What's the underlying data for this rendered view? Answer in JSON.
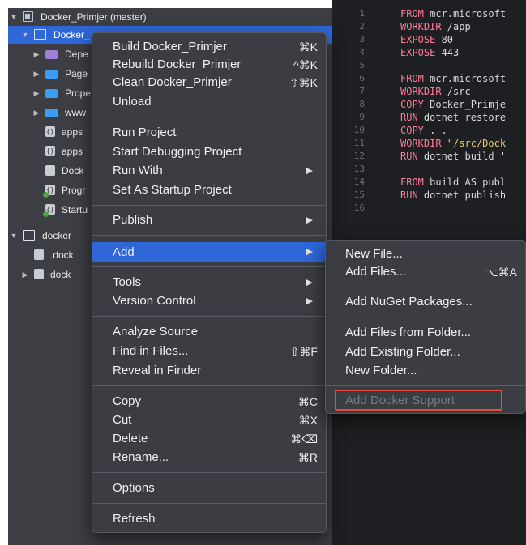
{
  "sidebar": {
    "rows": [
      {
        "label": "Docker_Primjer (master)",
        "twisty": "▼",
        "icon": "solution-icon"
      },
      {
        "label": "Docker_",
        "twisty": "▼",
        "icon": "project-icon"
      },
      {
        "label": "Depe",
        "twisty": "▶",
        "icon": "folder-icon"
      },
      {
        "label": "Page",
        "twisty": "▶",
        "icon": "folder-icon"
      },
      {
        "label": "Prope",
        "twisty": "▶",
        "icon": "folder-icon"
      },
      {
        "label": "www",
        "twisty": "▶",
        "icon": "folder-icon"
      },
      {
        "label": "apps",
        "twisty": "",
        "icon": "json-file-icon"
      },
      {
        "label": "apps",
        "twisty": "",
        "icon": "json-file-icon"
      },
      {
        "label": "Dock",
        "twisty": "",
        "icon": "file-icon"
      },
      {
        "label": "Progr",
        "twisty": "",
        "icon": "cs-file-icon"
      },
      {
        "label": "Startu",
        "twisty": "",
        "icon": "cs-file-icon"
      },
      {
        "label": "docker",
        "twisty": "▼",
        "icon": "project-icon"
      },
      {
        "label": ".dock",
        "twisty": "",
        "icon": "file-icon"
      },
      {
        "label": "dock",
        "twisty": "▶",
        "icon": "file-icon"
      }
    ]
  },
  "editor": {
    "line_numbers": [
      "1",
      "2",
      "3",
      "4",
      "5",
      "6",
      "7",
      "8",
      "9",
      "10",
      "11",
      "12",
      "13",
      "14",
      "15",
      "16"
    ],
    "lines": [
      {
        "kw": "FROM",
        "rest": " mcr.microsoft"
      },
      {
        "kw": "WORKDIR",
        "rest": " /app"
      },
      {
        "kw": "EXPOSE",
        "rest": " 80"
      },
      {
        "kw": "EXPOSE",
        "rest": " 443"
      },
      {
        "kw": "",
        "rest": ""
      },
      {
        "kw": "FROM",
        "rest": " mcr.microsoft"
      },
      {
        "kw": "WORKDIR",
        "rest": " /src"
      },
      {
        "kw": "COPY",
        "rest": " Docker_Primje"
      },
      {
        "kw": "RUN",
        "rest": " dotnet restore"
      },
      {
        "kw": "COPY",
        "rest": " . ."
      },
      {
        "kw": "WORKDIR",
        "rest": " \"/src/Dock",
        "str": true
      },
      {
        "kw": "RUN",
        "rest": " dotnet build '"
      },
      {
        "kw": "",
        "rest": ""
      },
      {
        "kw": "FROM",
        "rest": " build AS publ"
      },
      {
        "kw": "RUN",
        "rest": " dotnet publish"
      },
      {
        "kw": "",
        "rest": ""
      }
    ]
  },
  "context_menu": {
    "items": [
      {
        "label": "Build Docker_Primjer",
        "shortcut": "⌘K"
      },
      {
        "label": "Rebuild Docker_Primjer",
        "shortcut": "^⌘K"
      },
      {
        "label": "Clean Docker_Primjer",
        "shortcut": "⇧⌘K"
      },
      {
        "label": "Unload",
        "shortcut": ""
      },
      {
        "label": "Run Project",
        "shortcut": ""
      },
      {
        "label": "Start Debugging Project",
        "shortcut": ""
      },
      {
        "label": "Run With",
        "shortcut": ""
      },
      {
        "label": "Set As Startup Project",
        "shortcut": ""
      },
      {
        "label": "Publish",
        "shortcut": ""
      },
      {
        "label": "Add",
        "shortcut": ""
      },
      {
        "label": "Tools",
        "shortcut": ""
      },
      {
        "label": "Version Control",
        "shortcut": ""
      },
      {
        "label": "Analyze Source",
        "shortcut": ""
      },
      {
        "label": "Find in Files...",
        "shortcut": "⇧⌘F"
      },
      {
        "label": "Reveal in Finder",
        "shortcut": ""
      },
      {
        "label": "Copy",
        "shortcut": "⌘C"
      },
      {
        "label": "Cut",
        "shortcut": "⌘X"
      },
      {
        "label": "Delete",
        "shortcut": "⌘⌫"
      },
      {
        "label": "Rename...",
        "shortcut": "⌘R"
      },
      {
        "label": "Options",
        "shortcut": ""
      },
      {
        "label": "Refresh",
        "shortcut": ""
      }
    ],
    "submenu_arrow": "▶"
  },
  "add_submenu": {
    "items": [
      {
        "label": "New File...",
        "shortcut": ""
      },
      {
        "label": "Add Files...",
        "shortcut": "⌥⌘A"
      },
      {
        "label": "Add NuGet Packages...",
        "shortcut": ""
      },
      {
        "label": "Add Files from Folder...",
        "shortcut": ""
      },
      {
        "label": "Add Existing Folder...",
        "shortcut": ""
      },
      {
        "label": "New Folder...",
        "shortcut": ""
      },
      {
        "label": "Add Docker Support",
        "shortcut": ""
      }
    ]
  },
  "colors": {
    "accent": "#2f67d8",
    "highlight_outline": "#e74c3c",
    "menu_bg": "#3b3d42",
    "sidebar_bg": "#3c3e44",
    "editor_bg": "#1e1f22"
  }
}
